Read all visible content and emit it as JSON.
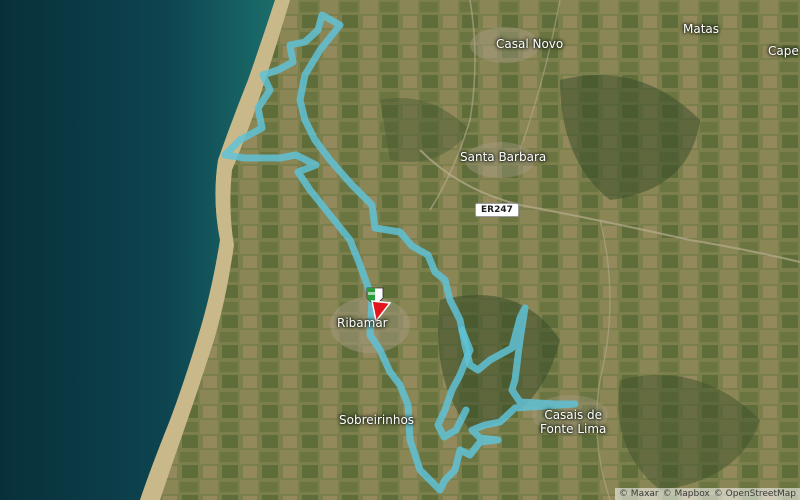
{
  "map": {
    "colors": {
      "sea": "#0f4a55",
      "deep_sea": "#08303a",
      "beach": "#c9b98a",
      "land": "#6f7a4a",
      "route": "#5fc2d6",
      "end_marker": "#e3141b"
    },
    "places": {
      "casal_novo": "Casal Novo",
      "matas": "Matas",
      "cape": "Cape",
      "santa_barbara": "Santa Barbara",
      "ribamar": "Ribamar",
      "sobreirinho": "Sobreirinhos",
      "casais_line1": "Casais de",
      "casais_line2": "Fonte Lima"
    },
    "road_shield": "ER247",
    "markers": {
      "start": "start-flag-icon",
      "end": "finish-pin-icon"
    },
    "attribution": [
      "© Maxar",
      "© Mapbox",
      "© OpenStreetMap"
    ]
  }
}
